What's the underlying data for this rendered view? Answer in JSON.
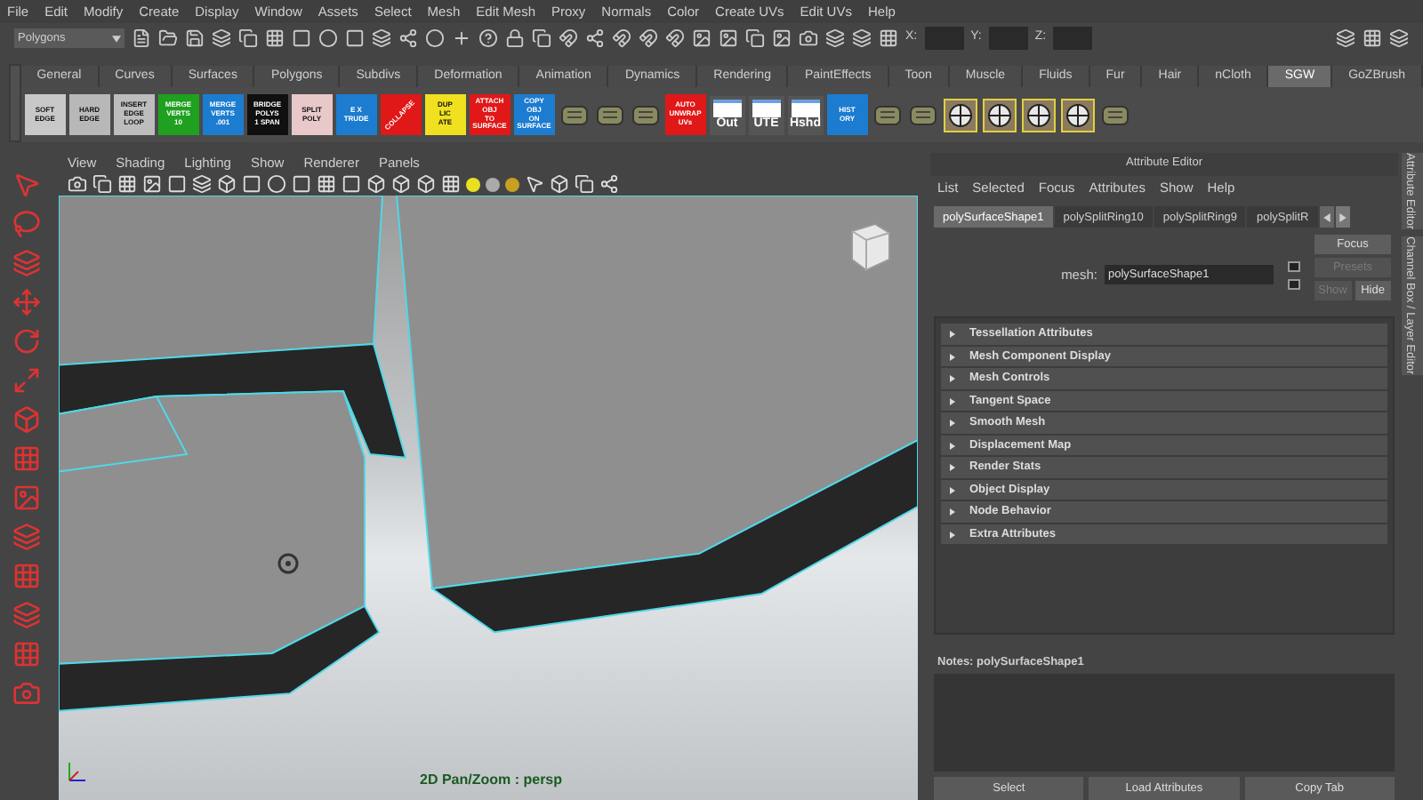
{
  "menu_bar": [
    "File",
    "Edit",
    "Modify",
    "Create",
    "Display",
    "Window",
    "Assets",
    "Select",
    "Mesh",
    "Edit Mesh",
    "Proxy",
    "Normals",
    "Color",
    "Create UVs",
    "Edit UVs",
    "Help"
  ],
  "status_line": {
    "mode": "Polygons",
    "coord_labels": [
      "X:",
      "Y:",
      "Z:"
    ]
  },
  "shelf_tabs": [
    {
      "label": "General",
      "selected": false
    },
    {
      "label": "Curves",
      "selected": false
    },
    {
      "label": "Surfaces",
      "selected": false
    },
    {
      "label": "Polygons",
      "selected": false
    },
    {
      "label": "Subdivs",
      "selected": false
    },
    {
      "label": "Deformation",
      "selected": false
    },
    {
      "label": "Animation",
      "selected": false
    },
    {
      "label": "Dynamics",
      "selected": false
    },
    {
      "label": "Rendering",
      "selected": false
    },
    {
      "label": "PaintEffects",
      "selected": false
    },
    {
      "label": "Toon",
      "selected": false
    },
    {
      "label": "Muscle",
      "selected": false
    },
    {
      "label": "Fluids",
      "selected": false
    },
    {
      "label": "Fur",
      "selected": false
    },
    {
      "label": "Hair",
      "selected": false
    },
    {
      "label": "nCloth",
      "selected": false
    },
    {
      "label": "SGW",
      "selected": true
    },
    {
      "label": "GoZBrush",
      "selected": false
    }
  ],
  "shelf_buttons": [
    {
      "kind": "text",
      "lines": [
        "SOFT",
        "EDGE"
      ],
      "color": "#c8c8c8"
    },
    {
      "kind": "text",
      "lines": [
        "HARD",
        "EDGE"
      ],
      "color": "#b8b8b8"
    },
    {
      "kind": "text",
      "lines": [
        "INSERT",
        "EDGE",
        "LOOP"
      ],
      "color": "#bdbdbd"
    },
    {
      "kind": "text",
      "lines": [
        "MERGE",
        "VERTS",
        "10"
      ],
      "color": "#20a020"
    },
    {
      "kind": "text",
      "lines": [
        "MERGE",
        "VERTS",
        ".001"
      ],
      "color": "#1c7cd0"
    },
    {
      "kind": "text",
      "lines": [
        "BRIDGE",
        "POLYS",
        "1 SPAN"
      ],
      "color": "#101010"
    },
    {
      "kind": "text",
      "lines": [
        "SPLIT",
        "POLY"
      ],
      "color": "#e8c8c8"
    },
    {
      "kind": "text",
      "lines": [
        "E X",
        "TRUDE"
      ],
      "color": "#1c7cd0"
    },
    {
      "kind": "slanted",
      "lines": [
        "COLLAPSE"
      ],
      "color": "#e01818"
    },
    {
      "kind": "text",
      "lines": [
        "DUP",
        "LIC",
        "ATE"
      ],
      "color": "#f0e020"
    },
    {
      "kind": "text",
      "lines": [
        "ATTACH",
        "OBJ",
        "TO",
        "SURFACE"
      ],
      "color": "#e01818"
    },
    {
      "kind": "text",
      "lines": [
        "COPY",
        "OBJ",
        "ON",
        "SURFACE"
      ],
      "color": "#1c7cd0"
    },
    {
      "kind": "icon"
    },
    {
      "kind": "icon"
    },
    {
      "kind": "icon"
    },
    {
      "kind": "text",
      "lines": [
        "AUTO",
        "UNWRAP",
        "UVs"
      ],
      "color": "#e01818"
    },
    {
      "kind": "window",
      "lines": [
        "Out"
      ]
    },
    {
      "kind": "window",
      "lines": [
        "UTE"
      ]
    },
    {
      "kind": "window",
      "lines": [
        "Hshd"
      ]
    },
    {
      "kind": "text",
      "lines": [
        "HIST",
        "ORY"
      ],
      "color": "#1c7cd0"
    },
    {
      "kind": "icon"
    },
    {
      "kind": "icon"
    },
    {
      "kind": "target"
    },
    {
      "kind": "target"
    },
    {
      "kind": "target"
    },
    {
      "kind": "target"
    },
    {
      "kind": "icon"
    }
  ],
  "viewport": {
    "menu": [
      "View",
      "Shading",
      "Lighting",
      "Show",
      "Renderer",
      "Panels"
    ],
    "hud": "2D Pan/Zoom : persp"
  },
  "attribute_editor": {
    "title": "Attribute Editor",
    "menu": [
      "List",
      "Selected",
      "Focus",
      "Attributes",
      "Show",
      "Help"
    ],
    "tabs": [
      {
        "label": "polySurfaceShape1",
        "selected": true
      },
      {
        "label": "polySplitRing10",
        "selected": false
      },
      {
        "label": "polySplitRing9",
        "selected": false
      },
      {
        "label": "polySplitR",
        "selected": false
      }
    ],
    "field_label": "mesh:",
    "field_value": "polySurfaceShape1",
    "side_buttons": [
      {
        "label": "Focus",
        "disabled": false
      },
      {
        "label": "Presets",
        "disabled": true
      }
    ],
    "show_hide": [
      {
        "label": "Show",
        "disabled": true
      },
      {
        "label": "Hide",
        "disabled": false
      }
    ],
    "sections": [
      {
        "label": "Tessellation Attributes",
        "expanded": false
      },
      {
        "label": "Mesh Component Display",
        "expanded": false
      },
      {
        "label": "Mesh Controls",
        "expanded": false
      },
      {
        "label": "Tangent Space",
        "expanded": false
      },
      {
        "label": "Smooth Mesh",
        "expanded": false
      },
      {
        "label": "Displacement Map",
        "expanded": false
      },
      {
        "label": "Render Stats",
        "expanded": false
      },
      {
        "label": "Object Display",
        "expanded": false
      },
      {
        "label": "Node Behavior",
        "expanded": false
      },
      {
        "label": "Extra Attributes",
        "expanded": false
      }
    ],
    "notes_label": "Notes:  polySurfaceShape1",
    "buttons": [
      "Select",
      "Load Attributes",
      "Copy Tab"
    ]
  },
  "side_tabs": [
    "Attribute Editor",
    "Channel Box / Layer Editor"
  ]
}
